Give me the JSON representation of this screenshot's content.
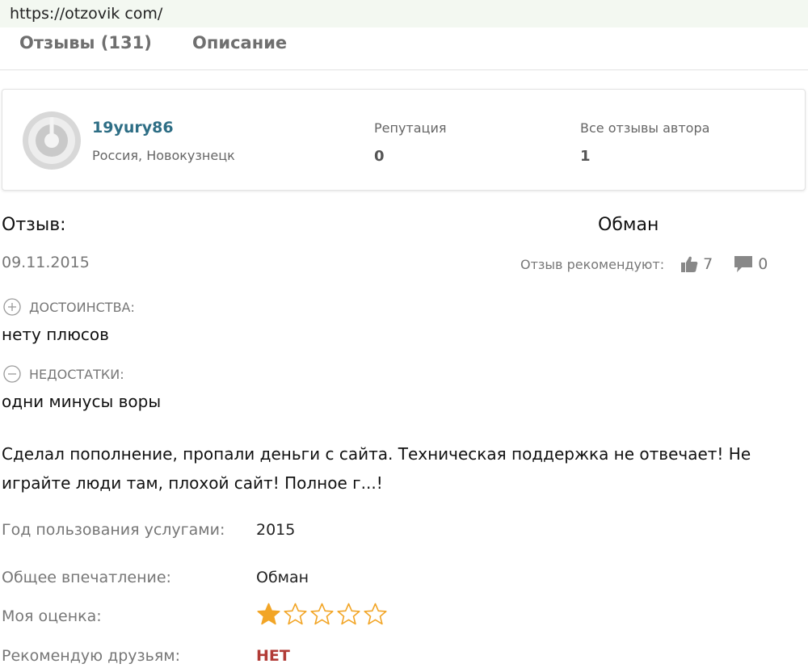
{
  "browser": {
    "url": "https://otzovik com/"
  },
  "tabs": [
    {
      "label": "Отзывы (131)"
    },
    {
      "label": "Описание"
    }
  ],
  "author": {
    "name": "19yury86",
    "location": "Россия, Новокузнецк",
    "reputation_label": "Репутация",
    "reputation_value": "0",
    "all_reviews_label": "Все отзывы автора",
    "all_reviews_value": "1",
    "avatar_icon": "default-avatar-icon"
  },
  "review": {
    "label": "Отзыв:",
    "title": "Обман",
    "date": "09.11.2015",
    "recommend_label": "Отзыв рекомендуют:",
    "likes": "7",
    "comments": "0",
    "pros_label": "ДОСТОИНСТВА:",
    "pros_text": "нету плюсов",
    "cons_label": "НЕДОСТАТКИ:",
    "cons_text": "одни минусы воры",
    "body": "Сделал пополнение, пропали деньги с сайта. Техническая поддержка не отвечает! Не играйте люди там, плохой сайт! Полное г...!"
  },
  "details": {
    "year_label": "Год пользования услугами:",
    "year_value": "2015",
    "impression_label": "Общее впечатление:",
    "impression_value": "Обман",
    "rating_label": "Моя оценка:",
    "rating_value": 1,
    "rating_max": 5,
    "recommend_label": "Рекомендую друзьям:",
    "recommend_value": "НЕТ"
  },
  "colors": {
    "link": "#2e6e85",
    "star_filled": "#f2a526",
    "star_empty_stroke": "#f2a526",
    "negative": "#b13b36",
    "muted": "#777777"
  }
}
